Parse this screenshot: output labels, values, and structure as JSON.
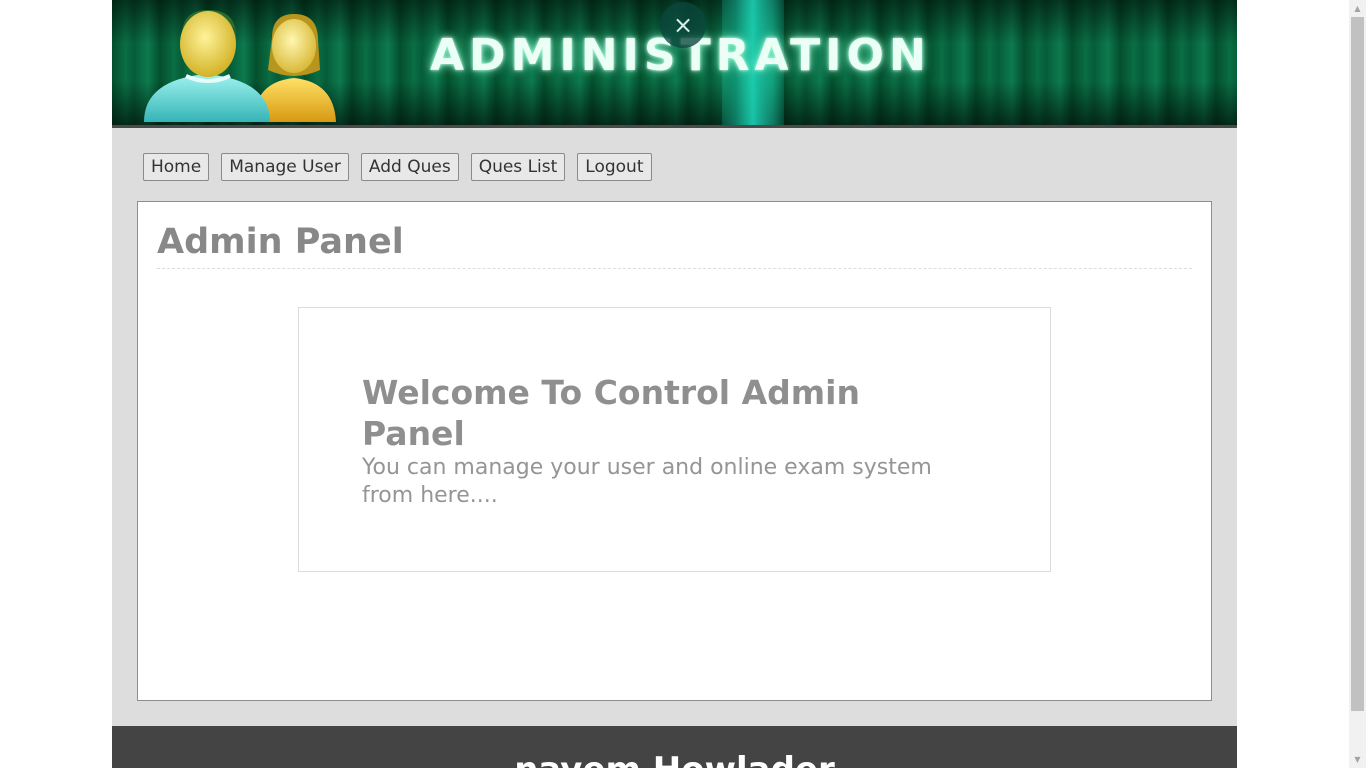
{
  "header": {
    "title": "ADMINISTRATION",
    "close_symbol": "×",
    "icon": "users-icon"
  },
  "nav": {
    "items": [
      {
        "label": "Home"
      },
      {
        "label": "Manage User"
      },
      {
        "label": "Add Ques"
      },
      {
        "label": "Ques List"
      },
      {
        "label": "Logout"
      }
    ]
  },
  "main": {
    "title": "Admin Panel",
    "welcome_heading": "Welcome To Control Admin Panel",
    "welcome_text": "You can manage your user and online exam system from here...."
  },
  "footer": {
    "text": "nayem Howlader"
  },
  "colors": {
    "banner": "#0a6e44",
    "page_bg": "#dddddd",
    "footer_bg": "#444444",
    "heading_text": "#888888"
  }
}
